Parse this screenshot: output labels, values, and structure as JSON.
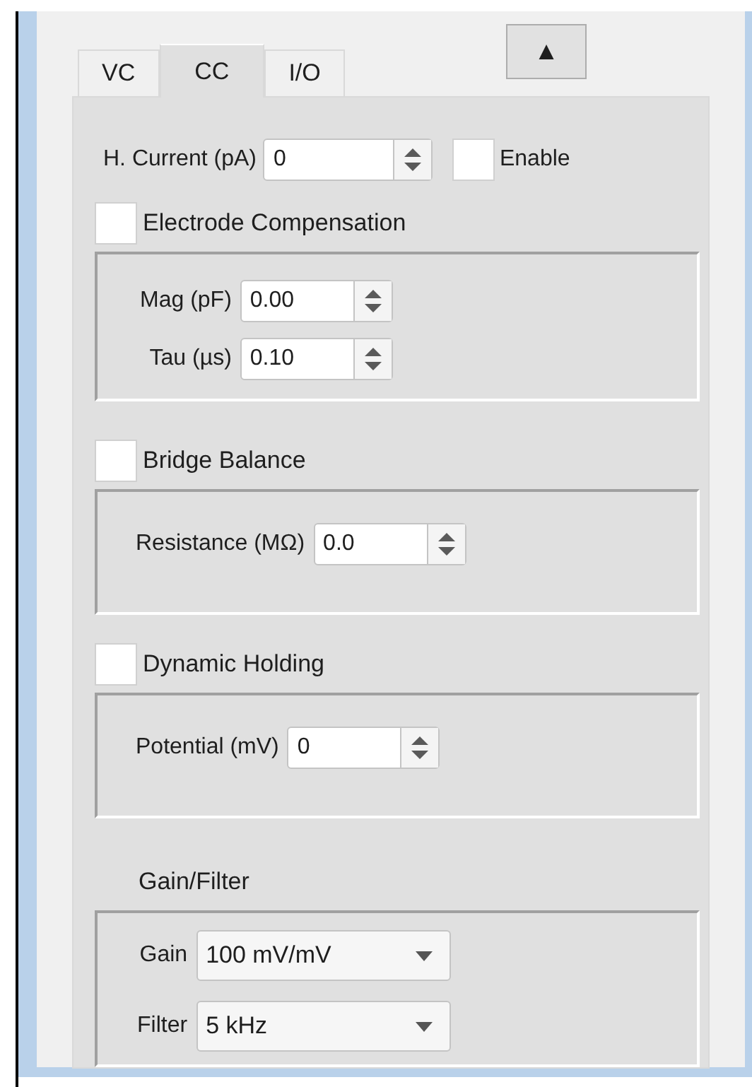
{
  "tabs": [
    {
      "label": "VC",
      "selected": false
    },
    {
      "label": "CC",
      "selected": true
    },
    {
      "label": "I/O",
      "selected": false
    }
  ],
  "collapse_button": {
    "label": "▲"
  },
  "holding_current": {
    "label": "H. Current (pA)",
    "value": "0"
  },
  "enable": {
    "label": "Enable",
    "checked": false
  },
  "sections": [
    {
      "kind": "checkable",
      "title": "Electrode Compensation",
      "checked": false,
      "fields": [
        {
          "kind": "spin",
          "label": "Mag (pF)",
          "value": "0.00"
        },
        {
          "kind": "spin",
          "label": "Tau (µs)",
          "value": "0.10"
        }
      ]
    },
    {
      "kind": "checkable",
      "title": "Bridge Balance",
      "checked": false,
      "fields": [
        {
          "kind": "spin",
          "label": "Resistance (MΩ)",
          "value": "0.0"
        }
      ]
    },
    {
      "kind": "checkable",
      "title": "Dynamic Holding",
      "checked": false,
      "fields": [
        {
          "kind": "spin",
          "label": "Potential (mV)",
          "value": "0"
        }
      ]
    },
    {
      "kind": "plain",
      "title": "Gain/Filter",
      "fields": [
        {
          "kind": "combo",
          "label": "Gain",
          "value": "100 mV/mV"
        },
        {
          "kind": "combo",
          "label": "Filter",
          "value": "5 kHz"
        }
      ]
    }
  ]
}
